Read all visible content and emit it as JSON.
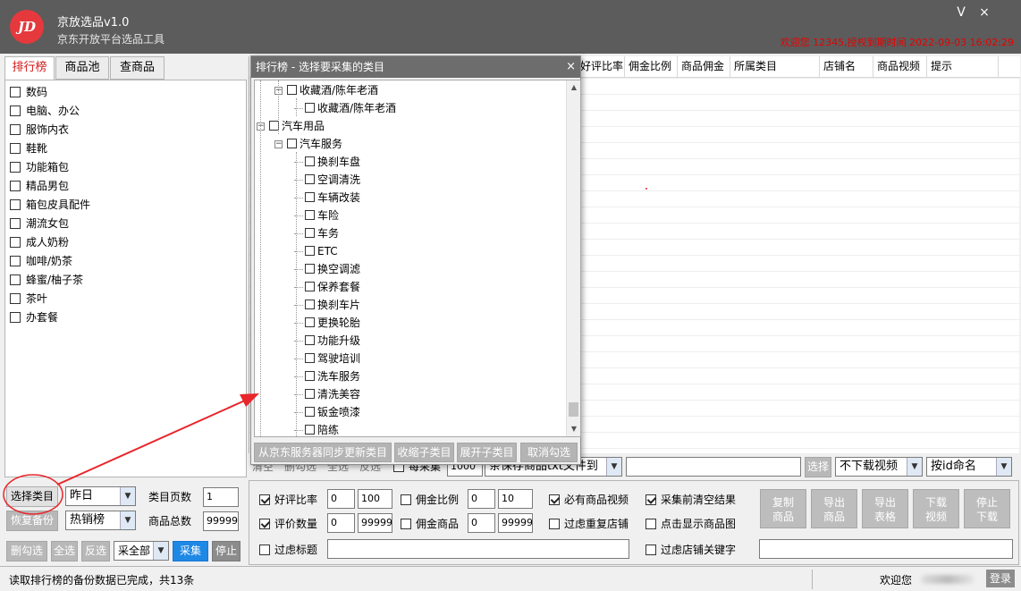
{
  "app": {
    "logo_text": "JD",
    "title": "京放选品v1.0",
    "subtitle": "京东开放平台选品工具",
    "auth_text": "欢迎您 12345,授权到期时间 2022-09-03 16:02:29",
    "minimize_glyph": "V",
    "close_glyph": "×"
  },
  "tabs": [
    {
      "label": "排行榜",
      "active": true
    },
    {
      "label": "商品池",
      "active": false
    },
    {
      "label": "查商品",
      "active": false
    }
  ],
  "categories": [
    "数码",
    "电脑、办公",
    "服饰内衣",
    "鞋靴",
    "功能箱包",
    "精品男包",
    "箱包皮具配件",
    "潮流女包",
    "成人奶粉",
    "咖啡/奶茶",
    "蜂蜜/柚子茶",
    "茶叶",
    "办套餐"
  ],
  "left_controls": {
    "select_category": "选择类目",
    "restore_backup": "恢复备份",
    "period_select": "昨日",
    "ranking_select": "热销榜",
    "category_pages_label": "类目页数",
    "category_pages_value": "1",
    "total_goods_label": "商品总数",
    "total_goods_value": "99999",
    "delete_checked": "删勾选",
    "select_all": "全选",
    "invert": "反选",
    "collect_all_select": "采全部",
    "collect": "采集",
    "stop": "停止"
  },
  "grid": {
    "columns": [
      "好评比率",
      "佣金比例",
      "商品佣金",
      "所属类目",
      "店铺名",
      "商品视频",
      "提示"
    ]
  },
  "dialog": {
    "title": "排行榜 - 选择要采集的类目",
    "close_glyph": "×",
    "tree": [
      {
        "label": "收藏酒/陈年老酒",
        "level": 1,
        "expander": "−"
      },
      {
        "label": "收藏酒/陈年老酒",
        "level": 2
      },
      {
        "label": "汽车用品",
        "level": 0,
        "expander": "−"
      },
      {
        "label": "汽车服务",
        "level": 1,
        "expander": "−"
      },
      {
        "label": "换刹车盘",
        "level": 2
      },
      {
        "label": "空调清洗",
        "level": 2
      },
      {
        "label": "车辆改装",
        "level": 2
      },
      {
        "label": "车险",
        "level": 2
      },
      {
        "label": "车务",
        "level": 2
      },
      {
        "label": "ETC",
        "level": 2
      },
      {
        "label": "换空调滤",
        "level": 2
      },
      {
        "label": "保养套餐",
        "level": 2
      },
      {
        "label": "换刹车片",
        "level": 2
      },
      {
        "label": "更换轮胎",
        "level": 2
      },
      {
        "label": "功能升级",
        "level": 2
      },
      {
        "label": "驾驶培训",
        "level": 2
      },
      {
        "label": "洗车服务",
        "level": 2
      },
      {
        "label": "清洗美容",
        "level": 2
      },
      {
        "label": "钣金喷漆",
        "level": 2
      },
      {
        "label": "陪练",
        "level": 2
      }
    ],
    "buttons": [
      "从京东服务器同步更新类目",
      "收缩子类目",
      "展开子类目",
      "取消勾选"
    ]
  },
  "row_bar": {
    "clear": "清空",
    "delete_checked": "删勾选",
    "select_all": "全选",
    "invert": "反选",
    "per_collect_label": "每采集",
    "per_collect_value": "1000",
    "save_mode": "条保存商品txt文件到",
    "path_value": "",
    "choose": "选择",
    "video_mode": "不下载视频",
    "naming_mode": "按id命名"
  },
  "options": {
    "good_rate_label": "好评比率",
    "good_rate_min": "0",
    "good_rate_max": "100",
    "commission_rate_label": "佣金比例",
    "commission_rate_min": "0",
    "commission_rate_max": "10",
    "must_video_label": "必有商品视频",
    "clear_before_label": "采集前清空结果",
    "review_count_label": "评价数量",
    "review_count_min": "0",
    "review_count_max": "999999",
    "commission_label": "佣金商品",
    "commission_min": "0",
    "commission_max": "99999",
    "filter_dup_store_label": "过虑重复店铺",
    "click_show_img_label": "点击显示商品图",
    "filter_title_label": "过虑标题",
    "filter_store_kw_label": "过虑店铺关键字"
  },
  "action_buttons": [
    {
      "line1": "复制",
      "line2": "商品"
    },
    {
      "line1": "导出",
      "line2": "商品"
    },
    {
      "line1": "导出",
      "line2": "表格"
    },
    {
      "line1": "下载",
      "line2": "视频"
    },
    {
      "line1": "停止",
      "line2": "下载"
    }
  ],
  "status": {
    "message": "读取排行榜的备份数据已完成，共13条",
    "welcome": "欢迎您",
    "login": "登录"
  },
  "colors": {
    "titlebar": "#5c5c5c",
    "accent_red": "#e60000",
    "collect_blue": "#1e88e5",
    "annotation_red": "#e8262b"
  }
}
